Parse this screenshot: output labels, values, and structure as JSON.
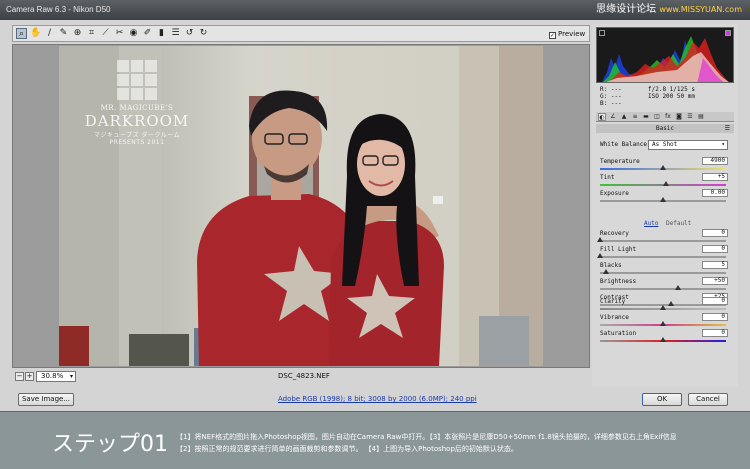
{
  "window": {
    "title": "Camera Raw 6.3  -  Nikon D50"
  },
  "watermark": {
    "text": "思缘设计论坛",
    "site": "www.MISSYUAN.com"
  },
  "toolbar": {
    "tools": [
      "zoom-icon",
      "hand-icon",
      "white-balance-icon",
      "color-sampler-icon",
      "target-adjust-icon",
      "crop-icon",
      "straighten-icon",
      "spot-removal-icon",
      "red-eye-icon",
      "adjustment-brush-icon",
      "graduated-filter-icon",
      "preferences-icon",
      "rotate-ccw-icon",
      "rotate-cw-icon"
    ],
    "preview_label": "Preview",
    "preview_checked": true
  },
  "photo": {
    "logo_small": "MR. MAGICUBE'S",
    "logo_big": "DARKROOM",
    "logo_jp": "マジキューブズ ダークルーム",
    "logo_presents": "PRESENTS 2011"
  },
  "bottom": {
    "zoom_minus": "−",
    "zoom_plus": "+",
    "zoom_value": "30.8%",
    "filename": "DSC_4823.NEF"
  },
  "footer": {
    "save_label": "Save Image...",
    "workflow": "Adobe RGB (1998); 8 bit; 3008 by 2000 (6.0MP); 240 ppi",
    "open_label": "OK",
    "cancel_label": "Cancel"
  },
  "panel": {
    "rgb_r": "R:  ---",
    "rgb_g": "G:  ---",
    "rgb_b": "B:  ---",
    "aperture_shutter": "f/2.8   1/125 s",
    "iso_lens": "ISO 200   50 mm",
    "section_title": "Basic",
    "wb_label": "White Balance:",
    "wb_value": "As Shot",
    "auto_label": "Auto",
    "default_label": "Default",
    "sliders": [
      {
        "label": "Temperature",
        "value": "4900",
        "pos": 0.5
      },
      {
        "label": "Tint",
        "value": "+5",
        "pos": 0.52
      },
      {
        "label": "Exposure",
        "value": "0.00",
        "pos": 0.5
      },
      {
        "label": "Recovery",
        "value": "0",
        "pos": 0.0
      },
      {
        "label": "Fill Light",
        "value": "0",
        "pos": 0.0
      },
      {
        "label": "Blacks",
        "value": "5",
        "pos": 0.05
      },
      {
        "label": "Brightness",
        "value": "+50",
        "pos": 0.62
      },
      {
        "label": "Contrast",
        "value": "+25",
        "pos": 0.56
      },
      {
        "label": "Clarity",
        "value": "0",
        "pos": 0.5
      },
      {
        "label": "Vibrance",
        "value": "0",
        "pos": 0.5
      },
      {
        "label": "Saturation",
        "value": "0",
        "pos": 0.5
      }
    ]
  },
  "caption": {
    "step": "ステップ01",
    "line1": "【1】将NEF格式的图片拖入Photoshop视图，图片自动在Camera Raw中打开。【3】本张照片是尼康D50+50mm f1.8镜头拍摄的，详细参数见右上角Exif信息",
    "line2": "【2】按照正常的规范要求进行简单的画面裁剪和参数调节。                    【4】上图为导入Photoshop后的初始默认状态。"
  },
  "colors": {
    "window_bg": "#d4d4d4",
    "caption_bg": "#8a9698",
    "shirt_red": "#a8262c",
    "link_blue": "#1a3aa8"
  }
}
